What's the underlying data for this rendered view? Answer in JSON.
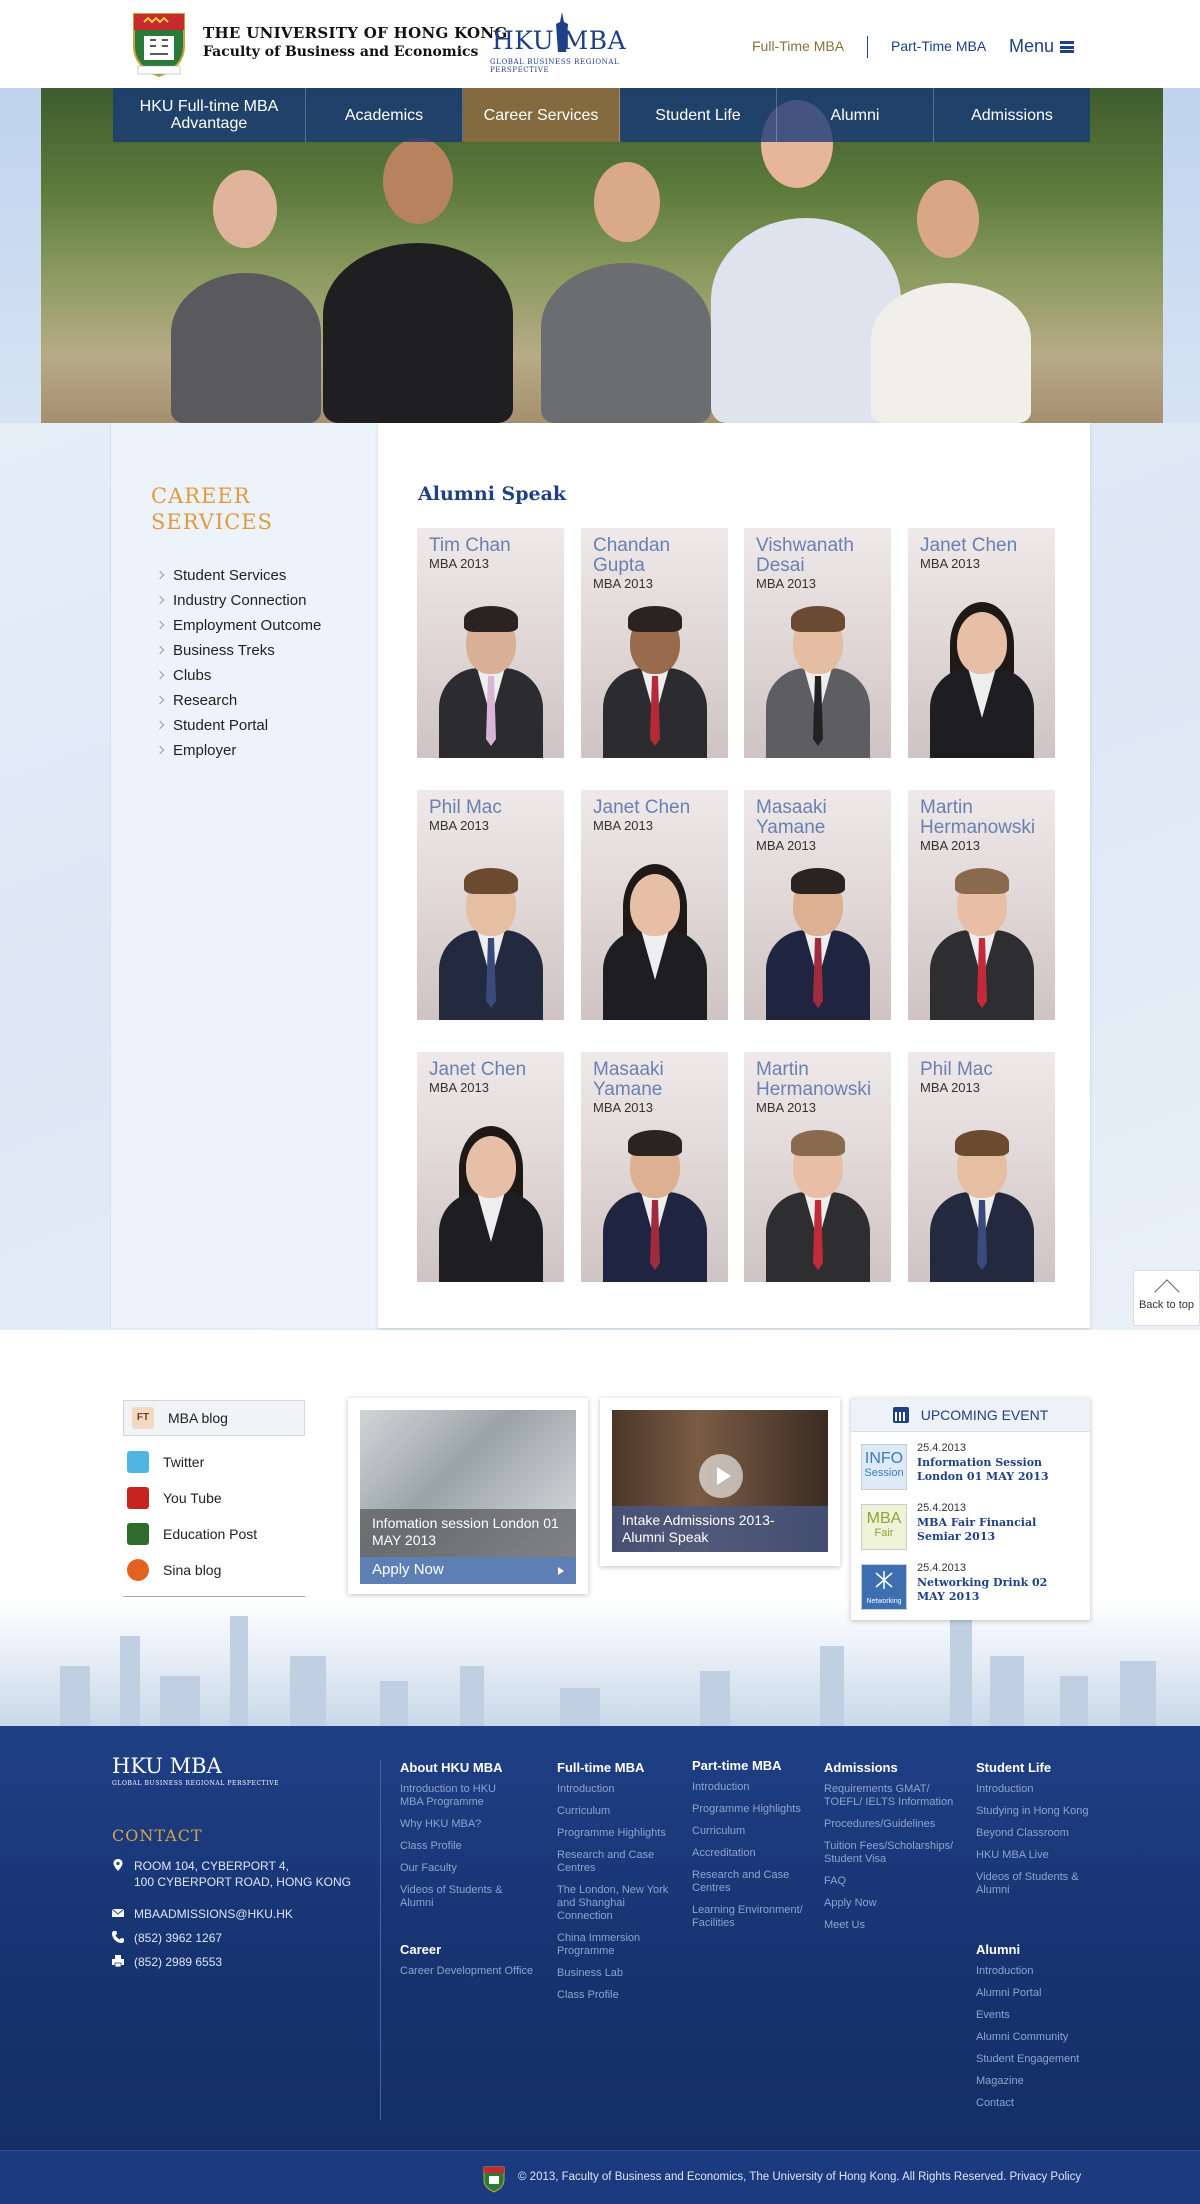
{
  "header": {
    "univ_line1": "THE UNIVERSITY OF HONG KONG",
    "univ_line2": "Faculty of Business and Economics",
    "mba_logo": "HKU MBA",
    "mba_tagline": "GLOBAL BUSINESS  REGIONAL PERSPECTIVE",
    "nav_fulltime": "Full-Time MBA",
    "nav_parttime": "Part-Time MBA",
    "menu_label": "Menu"
  },
  "mainnav": [
    {
      "label": "HKU Full-time MBA Advantage"
    },
    {
      "label": "Academics"
    },
    {
      "label": "Career Services"
    },
    {
      "label": "Student Life"
    },
    {
      "label": "Alumni"
    },
    {
      "label": "Admissions"
    }
  ],
  "sidebar": {
    "title_line1": "CAREER",
    "title_line2": "SERVICES",
    "items": [
      {
        "label": "Student Services"
      },
      {
        "label": "Industry Connection"
      },
      {
        "label": "Employment Outcome"
      },
      {
        "label": "Business Treks"
      },
      {
        "label": "Clubs"
      },
      {
        "label": "Research"
      },
      {
        "label": "Student Portal"
      },
      {
        "label": "Employer"
      }
    ]
  },
  "main": {
    "heading": "Alumni Speak",
    "alumni": [
      {
        "name": "Tim Chan",
        "year": "MBA 2013"
      },
      {
        "name": "Chandan Gupta",
        "year": "MBA 2013"
      },
      {
        "name": "Vishwanath Desai",
        "year": "MBA 2013"
      },
      {
        "name": "Janet Chen",
        "year": "MBA 2013"
      },
      {
        "name": "Phil Mac",
        "year": "MBA 2013"
      },
      {
        "name": "Janet Chen",
        "year": "MBA 2013"
      },
      {
        "name": "Masaaki Yamane",
        "year": "MBA 2013"
      },
      {
        "name": "Martin Hermanowski",
        "year": "MBA 2013"
      },
      {
        "name": "Janet Chen",
        "year": "MBA 2013"
      },
      {
        "name": "Masaaki Yamane",
        "year": "MBA 2013"
      },
      {
        "name": "Martin Hermanowski",
        "year": "MBA 2013"
      },
      {
        "name": "Phil Mac",
        "year": "MBA 2013"
      }
    ]
  },
  "back_to_top": "Back to top",
  "social": {
    "blog_badge": "FT",
    "blog": "MBA blog",
    "items": [
      {
        "label": "Twitter",
        "icon": "twitter-icon"
      },
      {
        "label": "You Tube",
        "icon": "youtube-icon"
      },
      {
        "label": "Education Post",
        "icon": "education-post-icon"
      },
      {
        "label": "Sina blog",
        "icon": "sina-blog-icon"
      }
    ]
  },
  "promo1": {
    "caption": "Infomation session London 01 MAY 2013",
    "button": "Apply Now"
  },
  "promo2": {
    "caption": "Intake Admissions 2013- Alumni Speak"
  },
  "events": {
    "title": "UPCOMING EVENT",
    "items": [
      {
        "badge_top": "INFO",
        "badge_bottom": "Session",
        "date": "25.4.2013",
        "title": "Information Session London  01 MAY 2013",
        "color": "#3c7bbf"
      },
      {
        "badge_top": "MBA",
        "badge_bottom": "Fair",
        "date": "25.4.2013",
        "title": "MBA Fair Financial Semiar 2013",
        "color": "#8fa43a"
      },
      {
        "badge_top": "",
        "badge_bottom": "Networking",
        "date": "25.4.2013",
        "title": "Networking Drink 02 MAY 2013",
        "color": "#3e6fb0"
      }
    ]
  },
  "footer": {
    "logo": "HKU MBA",
    "tagline": "GLOBAL BUSINESS  REGIONAL PERSPECTIVE",
    "contact_title": "CONTACT",
    "address_line1": "ROOM 104, CYBERPORT 4,",
    "address_line2": "100 CYBERPORT ROAD, HONG KONG",
    "email": "MBAADMISSIONS@HKU.HK",
    "phone": "(852) 3962 1267",
    "fax": "(852) 2989 6553",
    "columns": [
      {
        "title": "About HKU MBA",
        "links": [
          "Introduction to HKU MBA Programme",
          "Why HKU MBA?",
          "Class Profile",
          "Our Faculty",
          "Videos of Students & Alumni"
        ]
      },
      {
        "title": "Career",
        "links": [
          "Career Development Office"
        ]
      },
      {
        "title": "Full-time MBA",
        "links": [
          "Introduction",
          "Curriculum",
          "Programme Highlights",
          "Research and Case Centres",
          "The London, New York and Shanghai Connection",
          "China Immersion Programme",
          "Business Lab",
          "Class Profile"
        ]
      },
      {
        "title": "Part-time MBA",
        "links": [
          "Introduction",
          "Programme Highlights",
          "Curriculum",
          "Accreditation",
          "Research and Case Centres",
          "Learning Environment/ Facilities"
        ]
      },
      {
        "title": "Admissions",
        "links": [
          "Requirements GMAT/ TOEFL/ IELTS Information",
          "Procedures/Guidelines",
          "Tuition Fees/Scholarships/ Student Visa",
          "FAQ",
          "Apply Now",
          "Meet Us"
        ]
      },
      {
        "title": "Student Life",
        "links": [
          "Introduction",
          "Studying in Hong Kong",
          "Beyond Classroom",
          "HKU MBA Live",
          "Videos of Students & Alumni"
        ]
      },
      {
        "title": "Alumni",
        "links": [
          "Introduction",
          "Alumni Portal",
          "Events",
          "Alumni Community",
          "Student Engagement",
          "Magazine",
          "Contact"
        ]
      }
    ],
    "copyright": "© 2013, Faculty of Business and Economics, The University of Hong Kong. All Rights Reserved. Privacy Policy"
  }
}
